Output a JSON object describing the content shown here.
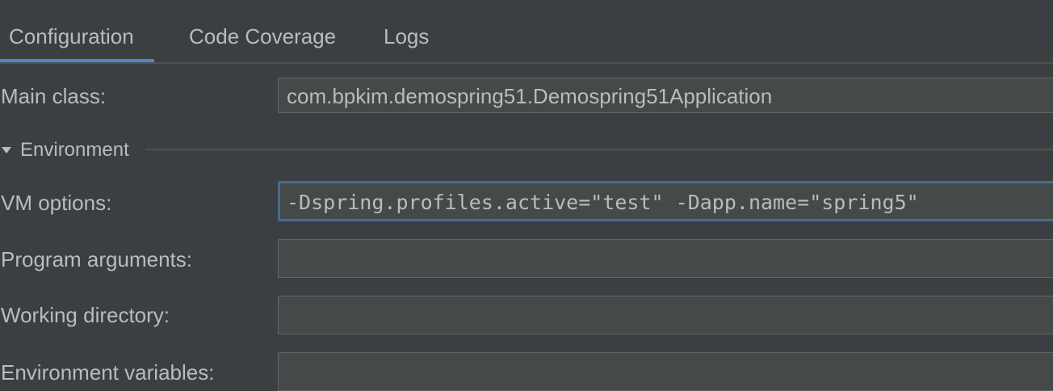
{
  "tabs": [
    {
      "label": "Configuration",
      "active": true
    },
    {
      "label": "Code Coverage",
      "active": false
    },
    {
      "label": "Logs",
      "active": false
    }
  ],
  "form": {
    "main_class": {
      "label": "Main class:",
      "value": "com.bpkim.demospring51.Demospring51Application"
    },
    "environment_section": {
      "label": "Environment",
      "expanded": true
    },
    "vm_options": {
      "label": "VM options:",
      "value": "-Dspring.profiles.active=\"test\" -Dapp.name=\"spring5\""
    },
    "program_arguments": {
      "label": "Program arguments:",
      "value": ""
    },
    "working_directory": {
      "label": "Working directory:",
      "value": ""
    },
    "environment_variables": {
      "label": "Environment variables:",
      "value": ""
    }
  },
  "colors": {
    "background": "#3c3f41",
    "text": "#bbbbbb",
    "field_background": "#45494a",
    "field_border": "#646464",
    "focus_border": "#466d94",
    "active_tab_underline": "#4a88c7"
  },
  "icons": {
    "section_toggle": "chevron-down-icon"
  }
}
